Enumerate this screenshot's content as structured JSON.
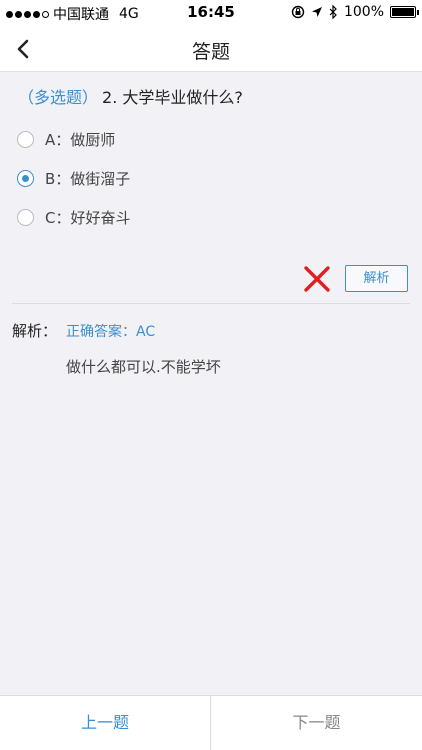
{
  "status_bar": {
    "carrier": "中国联通",
    "network": "4G",
    "time": "16:45",
    "battery": "100%",
    "battery_level": 1.0
  },
  "nav": {
    "title": "答题",
    "back_icon": "chevron-left-icon"
  },
  "question": {
    "type": "（多选题）",
    "text": "2. 大学毕业做什么?"
  },
  "options": [
    {
      "label": "A：做厨师",
      "checked": false
    },
    {
      "label": "B：做街溜子",
      "checked": true
    },
    {
      "label": "C：好好奋斗",
      "checked": false
    }
  ],
  "result": {
    "status_icon": "wrong-x-icon",
    "analysis_button": "解析"
  },
  "analysis": {
    "title": "解析：",
    "correct_answer": "正确答案：AC",
    "explanation": "做什么都可以.不能学坏"
  },
  "footer": {
    "prev": "上一题",
    "next": "下一题"
  },
  "colors": {
    "accent": "#3a8fd0",
    "wrong": "#e02020",
    "background": "#f2f2f6"
  }
}
